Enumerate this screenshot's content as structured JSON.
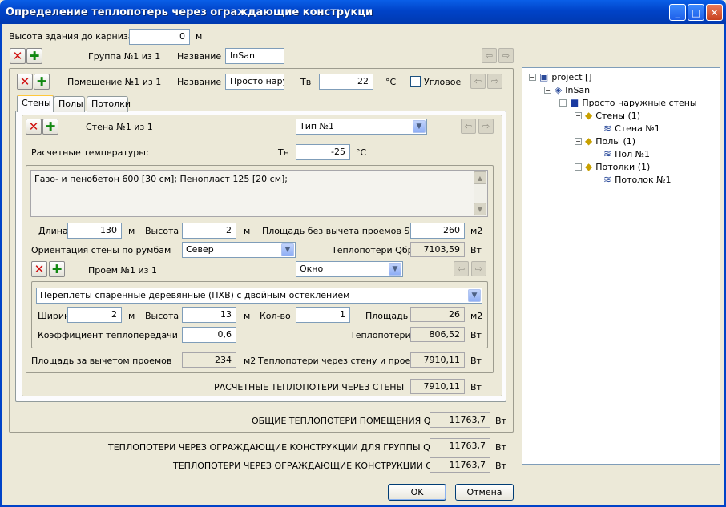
{
  "window": {
    "title": "Определение теплопотерь через ограждающие конструкци",
    "min": "_",
    "max": "□",
    "close": "✕"
  },
  "building": {
    "height_label": "Высота здания до карниза",
    "height_value": "0",
    "height_unit": "м"
  },
  "group": {
    "index_label": "Группа №1 из 1",
    "name_label": "Название",
    "name_value": "InSan"
  },
  "room": {
    "index_label": "Помещение №1 из 1",
    "name_label": "Название",
    "name_value": "Просто нару",
    "tv_label": "Тв",
    "tv_value": "22",
    "tv_unit": "°C",
    "corner_label": "Угловое"
  },
  "tabs": [
    "Стены",
    "Полы",
    "Потолки"
  ],
  "wall": {
    "index_label": "Стена №1 из 1",
    "type_value": "Тип №1",
    "temps_label": "Расчетные температуры:",
    "tn_label": "Тн",
    "tn_value": "-25",
    "tn_unit": "°C",
    "description": "Газо- и пенобетон 600 [30 см]; Пенопласт 125 [20 см];",
    "length_label": "Длина",
    "length_value": "130",
    "length_unit": "м",
    "height_label": "Высота",
    "height_value": "2",
    "height_unit": "м",
    "area_label": "Площадь без вычета проемов Sбр",
    "area_value": "260",
    "area_unit": "м2",
    "orient_label": "Ориентация стены по румбам",
    "orient_value": "Север",
    "loss_label": "Теплопотери Qбр",
    "loss_value": "7103,59",
    "loss_unit": "Вт"
  },
  "opening": {
    "index_label": "Проем №1 из 1",
    "type_value": "Окно",
    "frame_value": "Переплеты спаренные деревянные (ПХВ) с двойным остеклением",
    "width_label": "Ширина",
    "width_value": "2",
    "width_unit": "м",
    "height_label": "Высота",
    "height_value": "13",
    "height_unit": "м",
    "count_label": "Кол-во",
    "count_value": "1",
    "area_label": "Площадь",
    "area_value": "26",
    "area_unit": "м2",
    "coef_label": "Коэффициент теплопередачи",
    "coef_value": "0,6",
    "loss_label": "Теплопотери",
    "loss_value": "806,52",
    "loss_unit": "Вт"
  },
  "net": {
    "area_label": "Площадь за вычетом проемов",
    "area_value": "234",
    "area_unit": "м2",
    "loss_label": "Теплопотери через стену и проемы",
    "loss_value": "7910,11",
    "loss_unit": "Вт"
  },
  "totals": {
    "walls_label": "РАСЧЕТНЫЕ ТЕПЛОПОТЕРИ ЧЕРЕЗ СТЕНЫ",
    "walls_value": "7910,11",
    "room_label": "ОБЩИЕ ТЕПЛОПОТЕРИ ПОМЕЩЕНИЯ Q",
    "room_value": "11763,7",
    "group_label": "ТЕПЛОПОТЕРИ  ЧЕРЕЗ ОГРАЖДАЮЩИЕ КОНСТРУКЦИИ ДЛЯ ГРУППЫ Q",
    "group_value": "11763,7",
    "all_label": "ТЕПЛОПОТЕРИ ЧЕРЕЗ ОГРАЖДАЮЩИЕ КОНСТРУКЦИИ Q",
    "all_value": "11763,7",
    "unit": "Вт"
  },
  "buttons": {
    "ok": "OK",
    "cancel": "Отмена"
  },
  "tree": [
    "project []",
    "InSan",
    "Просто наружные стены",
    "Стены (1)",
    "Стена №1",
    "Полы (1)",
    "Пол №1",
    "Потолки (1)",
    "Потолок №1"
  ],
  "glyphs": {
    "del": "✕",
    "add": "✚",
    "left": "⇦",
    "right": "⇨",
    "down": "▼",
    "up": "▲",
    "minus": "−"
  }
}
